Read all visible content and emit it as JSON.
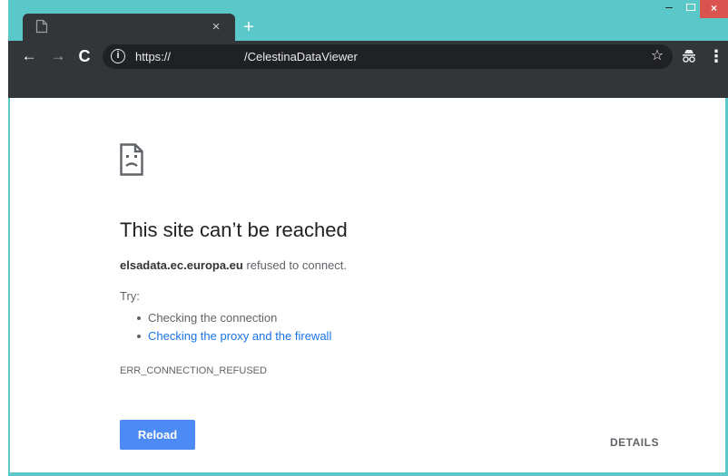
{
  "window": {
    "tab_close_glyph": "×",
    "new_tab_glyph": "+",
    "minimize_glyph": "–",
    "close_glyph": "×"
  },
  "toolbar": {
    "back_glyph": "←",
    "forward_glyph": "→",
    "reload_glyph": "C",
    "info_glyph": "i",
    "url_scheme": "https://",
    "url_path": "/CelestinaDataViewer",
    "star_glyph": "☆",
    "menu_glyph": "⋮"
  },
  "error_page": {
    "heading": "This site can’t be reached",
    "host": "elsadata.ec.europa.eu",
    "refused_text": " refused to connect.",
    "try_label": "Try:",
    "suggestions": [
      "Checking the connection",
      "Checking the proxy and the firewall"
    ],
    "error_code": "ERR_CONNECTION_REFUSED",
    "reload_label": "Reload",
    "details_label": "DETAILS"
  },
  "icons": {
    "tab": "page-icon",
    "error": "sad-document-icon",
    "extension": "incognito-icon"
  },
  "colors": {
    "titlebar": "#5ac8c8",
    "toolbar": "#323639",
    "omnibox": "#202124",
    "link": "#1a73e8",
    "reload_button": "#4c8bf5",
    "close_button": "#d9534f"
  }
}
